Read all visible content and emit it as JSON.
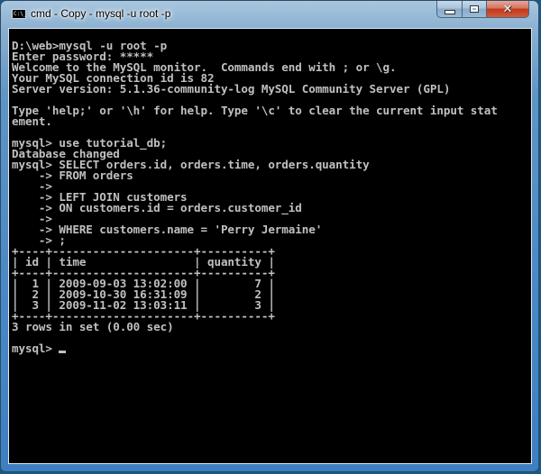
{
  "window": {
    "title": "cmd - Copy - mysql  -u root -p",
    "icon": "command-prompt-icon",
    "icon_text": "C:\\_",
    "controls": {
      "minimize": "minimize-icon",
      "maximize": "maximize-icon",
      "close": "✕"
    }
  },
  "console": {
    "lines": [
      "D:\\web>mysql -u root -p",
      "Enter password: *****",
      "Welcome to the MySQL monitor.  Commands end with ; or \\g.",
      "Your MySQL connection id is 82",
      "Server version: 5.1.36-community-log MySQL Community Server (GPL)",
      "",
      "Type 'help;' or '\\h' for help. Type '\\c' to clear the current input stat",
      "ement.",
      "",
      "mysql> use tutorial_db;",
      "Database changed",
      "mysql> SELECT orders.id, orders.time, orders.quantity",
      "    -> FROM orders",
      "    ->",
      "    -> LEFT JOIN customers",
      "    -> ON customers.id = orders.customer_id",
      "    ->",
      "    -> WHERE customers.name = 'Perry Jermaine'",
      "    -> ;",
      "+----+---------------------+----------+",
      "| id | time                | quantity |",
      "+----+---------------------+----------+",
      "|  1 | 2009-09-03 13:02:00 |        7 |",
      "|  2 | 2009-10-30 16:31:09 |        2 |",
      "|  3 | 2009-11-02 13:03:11 |        3 |",
      "+----+---------------------+----------+",
      "3 rows in set (0.00 sec)",
      ""
    ],
    "prompt": "mysql> ",
    "result_table": {
      "columns": [
        "id",
        "time",
        "quantity"
      ],
      "rows": [
        [
          "1",
          "2009-09-03 13:02:00",
          "7"
        ],
        [
          "2",
          "2009-10-30 16:31:09",
          "2"
        ],
        [
          "3",
          "2009-11-02 13:03:11",
          "3"
        ]
      ],
      "summary": "3 rows in set (0.00 sec)"
    }
  }
}
